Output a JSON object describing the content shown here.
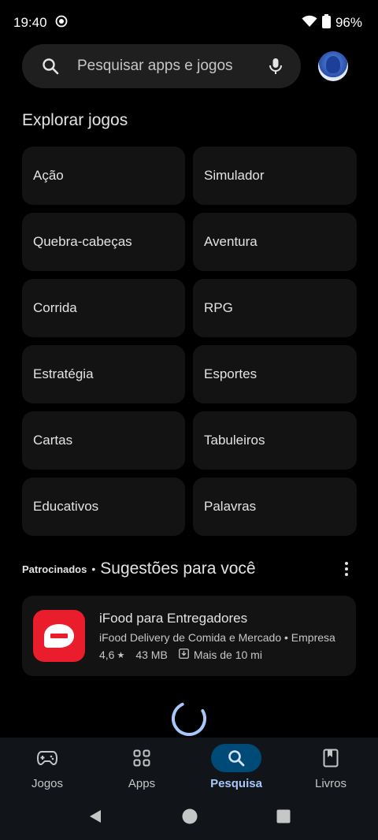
{
  "status": {
    "time": "19:40",
    "battery": "96%"
  },
  "search": {
    "placeholder": "Pesquisar apps e jogos"
  },
  "explore": {
    "title": "Explorar jogos",
    "categories": [
      "Ação",
      "Simulador",
      "Quebra-cabeças",
      "Aventura",
      "Corrida",
      "RPG",
      "Estratégia",
      "Esportes",
      "Cartas",
      "Tabuleiros",
      "Educativos",
      "Palavras"
    ]
  },
  "suggestions": {
    "sponsored_label": "Patrocinados",
    "separator": "•",
    "title": "Sugestões para você",
    "app": {
      "name": "iFood para Entregadores",
      "developer": "iFood Delivery de Comida e Mercado",
      "category": "Empresa",
      "rating": "4,6",
      "size": "43 MB",
      "installs": "Mais de 10 mi"
    }
  },
  "bottom_nav": {
    "items": [
      {
        "label": "Jogos",
        "icon": "gamepad-icon"
      },
      {
        "label": "Apps",
        "icon": "apps-grid-icon"
      },
      {
        "label": "Pesquisa",
        "icon": "search-icon",
        "active": true
      },
      {
        "label": "Livros",
        "icon": "book-icon"
      }
    ]
  },
  "colors": {
    "accent": "#a8c7fa",
    "active_pill": "#004a77",
    "ifood_red": "#ea1d2c"
  }
}
